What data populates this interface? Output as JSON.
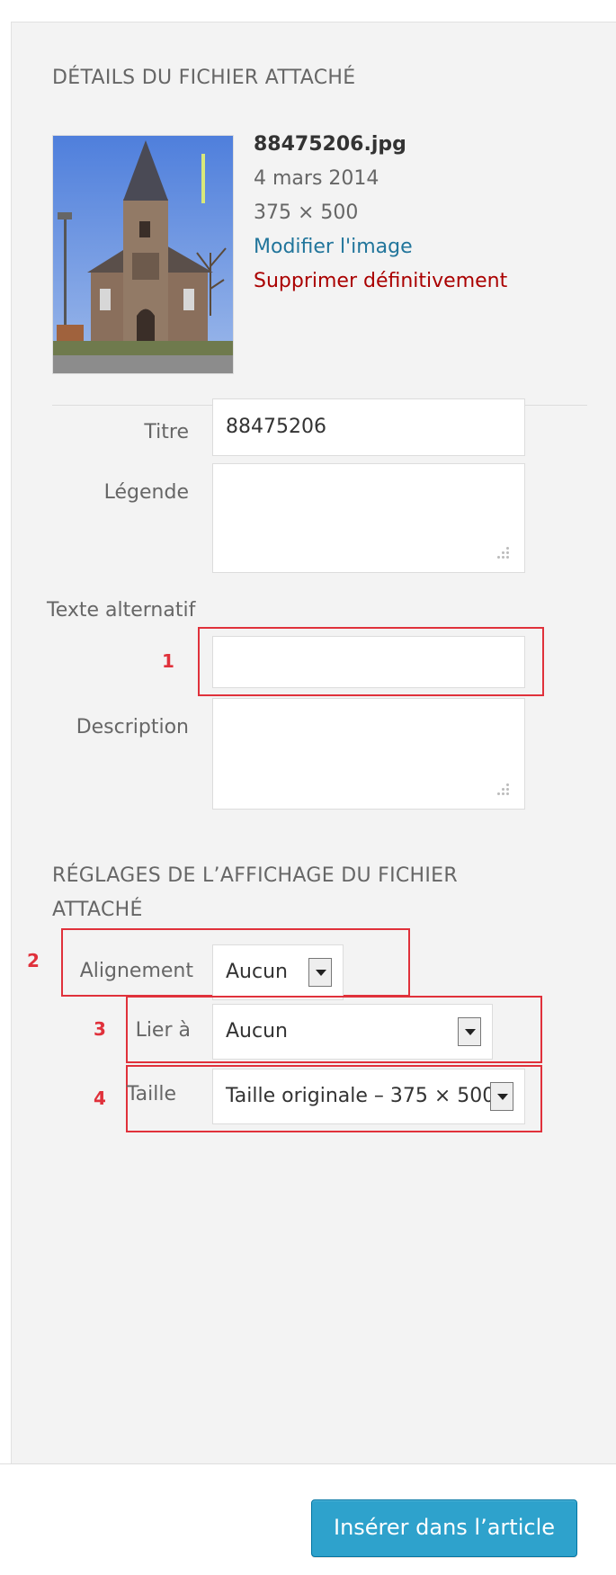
{
  "details": {
    "section_title": "DÉTAILS DU FICHIER ATTACHÉ",
    "file_name": "88475206.jpg",
    "date": "4 mars 2014",
    "dimensions": "375 × 500",
    "edit_link": "Modifier l'image",
    "delete_link": "Supprimer définitivement"
  },
  "fields": {
    "title_label": "Titre",
    "title_value": "88475206",
    "caption_label": "Légende",
    "alt_label": "Texte alternatif",
    "description_label": "Description"
  },
  "display": {
    "section_title_line1": "RÉGLAGES DE L’AFFICHAGE DU FICHIER",
    "section_title_line2": "ATTACHÉ",
    "alignment_label": "Alignement",
    "alignment_value": "Aucun",
    "link_label": "Lier à",
    "link_value": "Aucun",
    "size_label": "Taille",
    "size_value": "Taille originale – 375 × 500"
  },
  "annotations": [
    "1",
    "2",
    "3",
    "4"
  ],
  "footer": {
    "insert_button": "Insérer dans l’article"
  },
  "colors": {
    "accent": "#2ea2cc",
    "link": "#21759b",
    "danger": "#aa0000",
    "annotation": "#e0313b"
  }
}
